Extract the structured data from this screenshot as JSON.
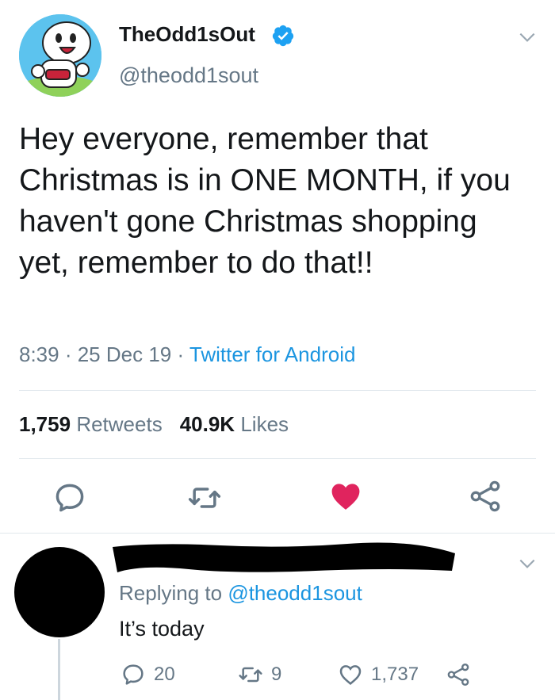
{
  "tweet": {
    "display_name": "TheOdd1sOut",
    "handle": "@theodd1sout",
    "text": "Hey everyone, remember that Christmas is in ONE MONTH, if you haven't gone Christmas shopping yet, remember to do that!!",
    "time": "8:39",
    "sep1": " · ",
    "date": "25 Dec 19",
    "sep2": " · ",
    "source": "Twitter for Android",
    "retweets_count": "1,759",
    "retweets_label": "Retweets",
    "likes_count": "40.9K",
    "likes_label": "Likes",
    "liked": true,
    "like_color": "#e0245e",
    "icons": [
      "verified-icon",
      "chevron-down-icon",
      "reply-icon",
      "retweet-icon",
      "heart-icon",
      "share-icon"
    ]
  },
  "reply": {
    "replying_prefix": "Replying to ",
    "replying_to": "@theodd1sout",
    "text": "It’s today",
    "reply_count": "20",
    "retweet_count": "9",
    "like_count": "1,737"
  },
  "colors": {
    "accent": "#1b95e0",
    "muted": "#657786",
    "text": "#14171a",
    "divider": "#e1e8ed",
    "verified": "#1da1f2"
  }
}
